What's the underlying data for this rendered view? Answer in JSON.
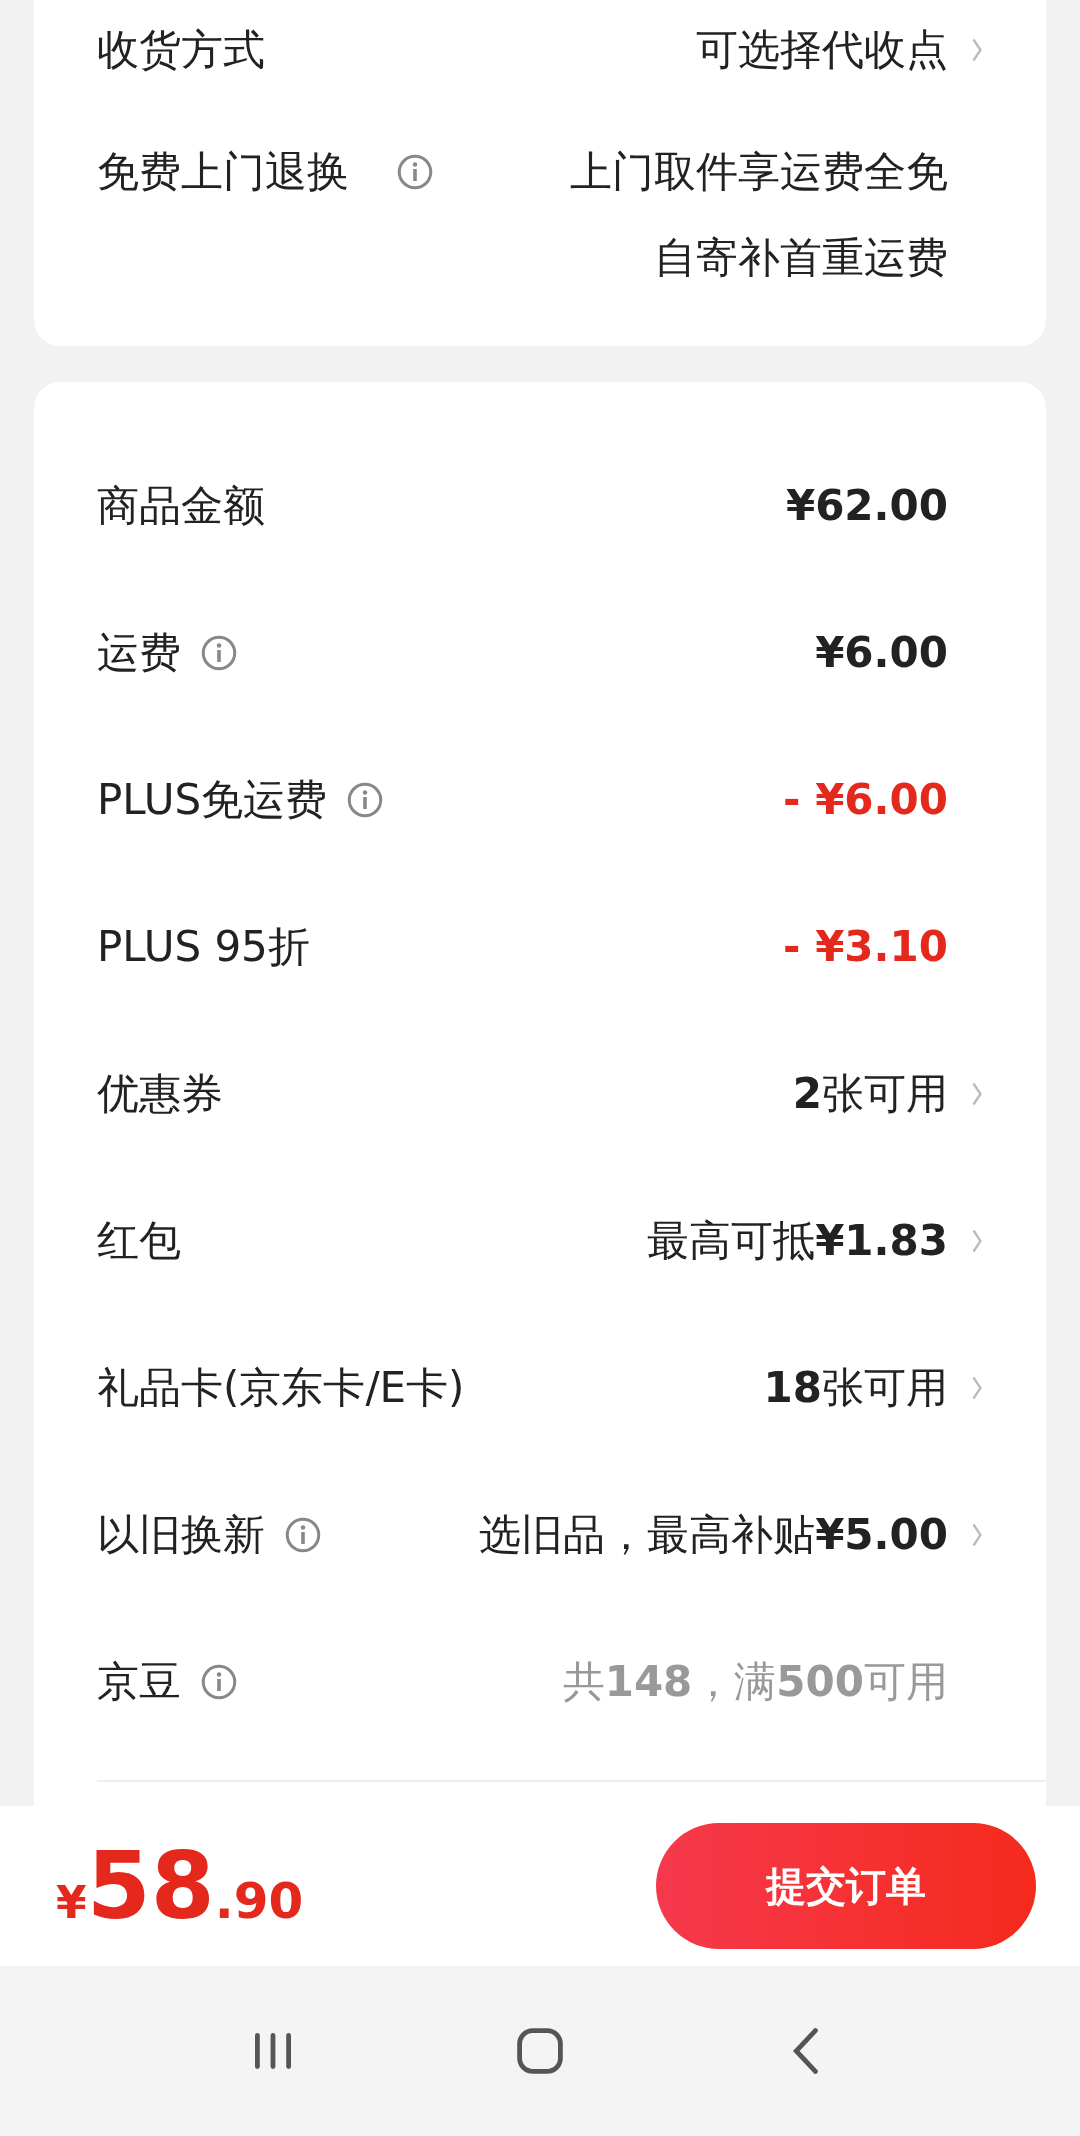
{
  "delivery_card": {
    "rows": [
      {
        "label": "收货方式",
        "info": false,
        "lines": [
          "可选择代收点"
        ],
        "arrow": true
      },
      {
        "label": "免费上门退换",
        "info": true,
        "lines": [
          "上门取件享运费全免",
          "自寄补首重运费"
        ],
        "arrow": false
      }
    ]
  },
  "summary_card": {
    "rows": [
      {
        "label": "商品金额",
        "info": false,
        "value": "¥62.00",
        "kind": "amount",
        "arrow": false
      },
      {
        "label": "运费",
        "info": true,
        "value": "¥6.00",
        "kind": "amount",
        "arrow": false
      },
      {
        "label": "PLUS免运费",
        "info": true,
        "value": "- ¥6.00",
        "kind": "discount",
        "arrow": false
      },
      {
        "label": "PLUS 95折",
        "info": false,
        "value": "- ¥3.10",
        "kind": "discount",
        "arrow": false
      },
      {
        "label": "优惠券",
        "info": false,
        "value": "**2**张可用",
        "kind": "normal",
        "arrow": true
      },
      {
        "label": "红包",
        "info": false,
        "value": "最高可抵**¥1.83**",
        "kind": "normal",
        "arrow": true
      },
      {
        "label": "礼品卡(京东卡/E卡)",
        "info": false,
        "value": "**18**张可用",
        "kind": "normal",
        "arrow": true
      },
      {
        "label": "以旧换新",
        "info": true,
        "value": "选旧品，最高补贴**¥5.00**",
        "kind": "normal",
        "arrow": true
      },
      {
        "label": "京豆",
        "info": true,
        "value": "共**148**，满**500**可用",
        "kind": "muted",
        "arrow": false
      }
    ]
  },
  "checkout_bar": {
    "currency": "¥",
    "price_integer": "58",
    "price_decimal": ".90",
    "submit_button": "提交订单"
  }
}
